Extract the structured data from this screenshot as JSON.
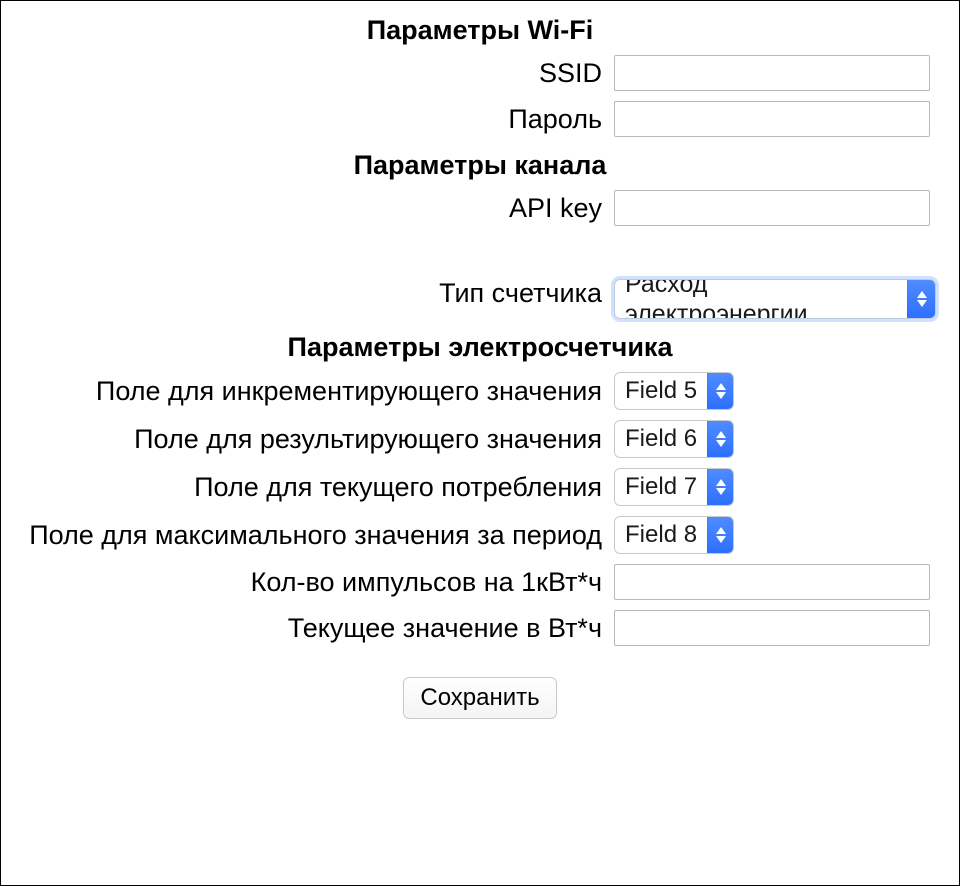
{
  "headings": {
    "wifi": "Параметры Wi-Fi",
    "channel": "Параметры канала",
    "meter": "Параметры электросчетчика"
  },
  "labels": {
    "ssid": "SSID",
    "password": "Пароль",
    "api_key": "API key",
    "counter_type": "Тип счетчика",
    "field_inc": "Поле для инкрементирующего значения",
    "field_res": "Поле для результирующего значения",
    "field_cur": "Поле для текущего потребления",
    "field_max": "Поле для максимального значения за период",
    "pulses": "Кол-во импульсов на 1кВт*ч",
    "current_val": "Текущее значение в Вт*ч"
  },
  "values": {
    "ssid": "",
    "password": "",
    "api_key": "",
    "counter_type": "Расход электроэнергии",
    "field_inc": "Field 5",
    "field_res": "Field 6",
    "field_cur": "Field 7",
    "field_max": "Field 8",
    "pulses": "",
    "current_val": ""
  },
  "buttons": {
    "save": "Сохранить"
  }
}
